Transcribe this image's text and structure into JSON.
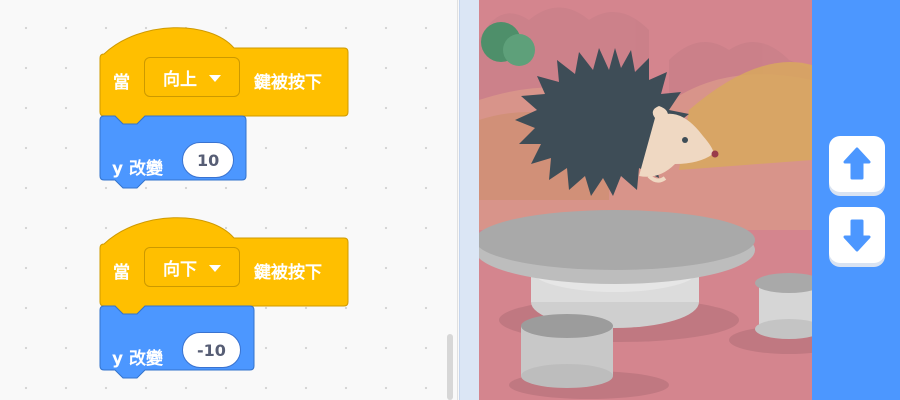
{
  "scripts": [
    {
      "hat_when": "當",
      "key": "向上",
      "hat_pressed": "鍵被按下",
      "motion_label": "y 改變",
      "value": "10"
    },
    {
      "hat_when": "當",
      "key": "向下",
      "hat_pressed": "鍵被按下",
      "motion_label": "y 改變",
      "value": "-10"
    }
  ],
  "colors": {
    "events_block": "#ffbf00",
    "motion_block": "#4c97ff",
    "stage_background": "#d4858e",
    "buttons_panel": "#4c97ff"
  },
  "icons": {
    "up_button": "arrow-up-icon",
    "down_button": "arrow-down-icon"
  }
}
